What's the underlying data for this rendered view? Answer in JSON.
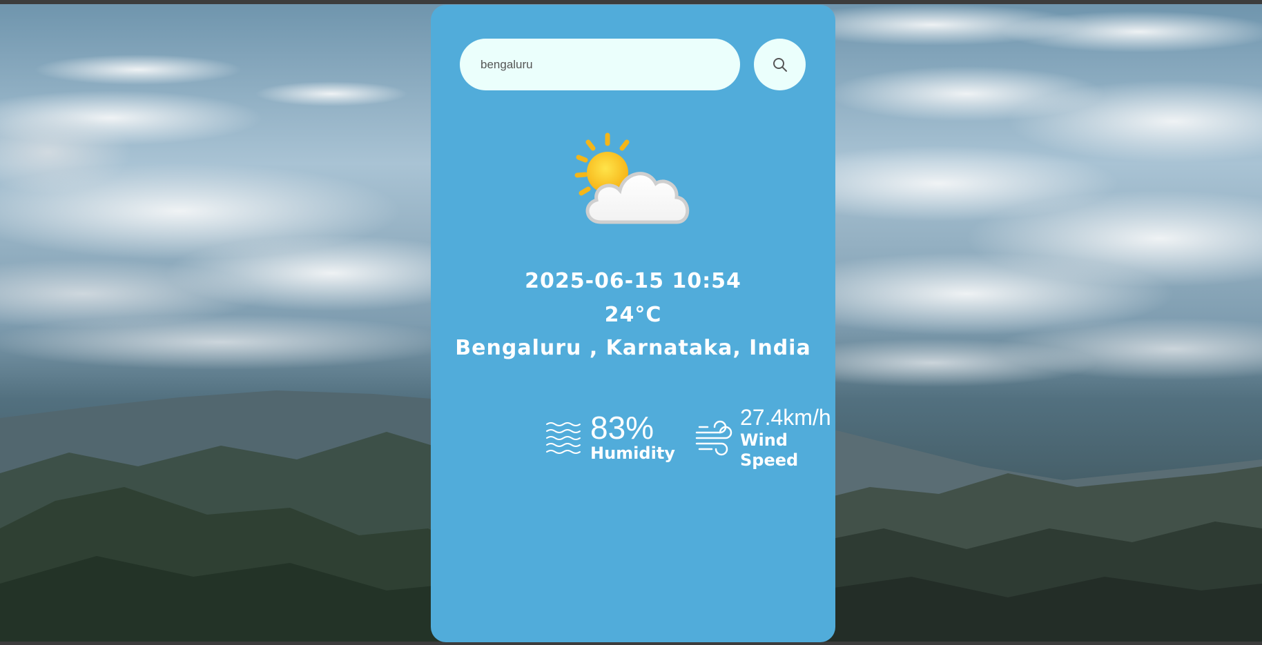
{
  "search": {
    "value": "bengaluru",
    "icon": "search-icon"
  },
  "weather": {
    "icon": "partly-cloudy-icon",
    "datetime": "2025-06-15 10:54",
    "temperature": "24°C",
    "location": "Bengaluru , Karnataka, India"
  },
  "stats": {
    "humidity": {
      "icon": "humidity-icon",
      "value": "83%",
      "label": "Humidity"
    },
    "wind": {
      "icon": "wind-icon",
      "value": "27.4km/h",
      "label": "Wind Speed"
    }
  },
  "colors": {
    "card": "#51acda",
    "input_background": "#ebfffc",
    "text": "#ffffff"
  }
}
